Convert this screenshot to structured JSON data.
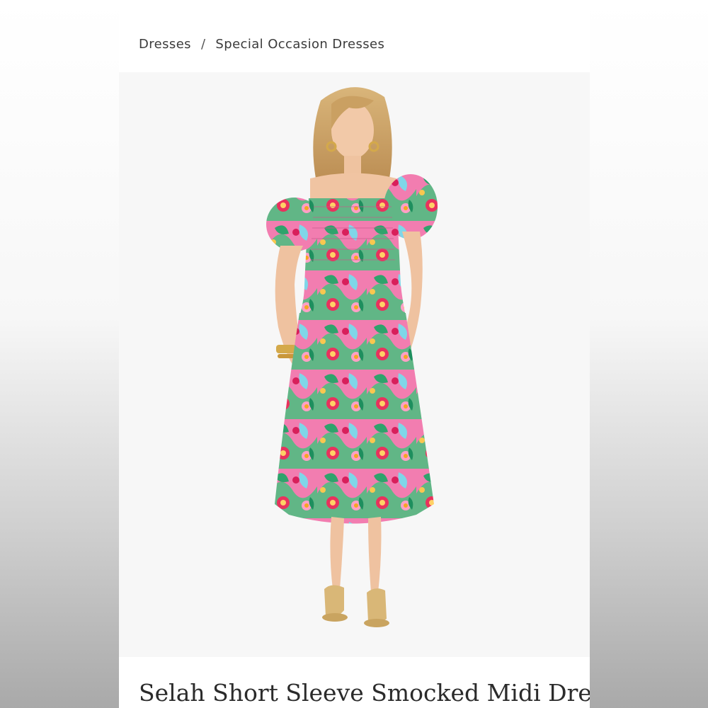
{
  "breadcrumb": {
    "items": [
      {
        "label": "Dresses"
      },
      {
        "label": "Special Occasion Dresses"
      }
    ],
    "separator": "/"
  },
  "product": {
    "title": "Selah Short Sleeve Smocked Midi Dress",
    "image_subject": "model wearing floral print smocked midi dress"
  },
  "colors": {
    "text": "#3b3b3b",
    "image_background": "#f7f7f7",
    "dress_pink": "#f06fa5",
    "dress_green": "#3fbf7a"
  }
}
